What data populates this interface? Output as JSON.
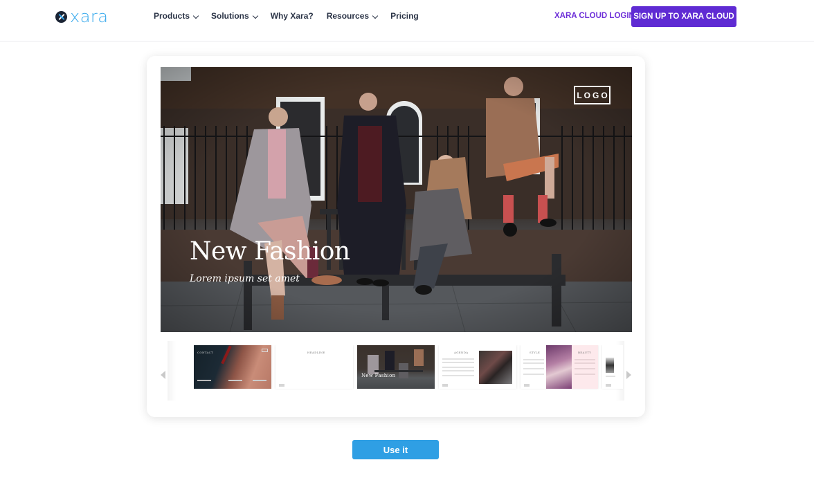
{
  "header": {
    "logo_text": "xara",
    "nav": [
      {
        "label": "Products",
        "has_dropdown": true
      },
      {
        "label": "Solutions",
        "has_dropdown": true
      },
      {
        "label": "Why Xara?",
        "has_dropdown": false
      },
      {
        "label": "Resources",
        "has_dropdown": true
      },
      {
        "label": "Pricing",
        "has_dropdown": false
      }
    ],
    "login_label": "XARA CLOUD LOGIN",
    "signup_label": "SIGN UP TO XARA CLOUD"
  },
  "preview": {
    "main_slide": {
      "title": "New Fashion",
      "subtitle": "Lorem ipsum set amet",
      "logo_text": "LOGO"
    },
    "thumbnails": [
      {
        "label": "CONTACT",
        "theme": "dark-photo"
      },
      {
        "label": "HEADLINE",
        "theme": "blank"
      },
      {
        "label": "New Fashion",
        "theme": "fashion-photo"
      },
      {
        "label": "AGENDA",
        "theme": "text-photo"
      },
      {
        "label": "STYLE",
        "label2": "BEAUTY",
        "theme": "split-pink"
      },
      {
        "label": "",
        "theme": "partial"
      }
    ]
  },
  "colors": {
    "brand_blue": "#35a8ec",
    "signup_purple": "#5f2bd3",
    "login_purple": "#6d2fd8",
    "cta_blue": "#2f9fe4"
  },
  "cta": {
    "use_label": "Use it"
  }
}
